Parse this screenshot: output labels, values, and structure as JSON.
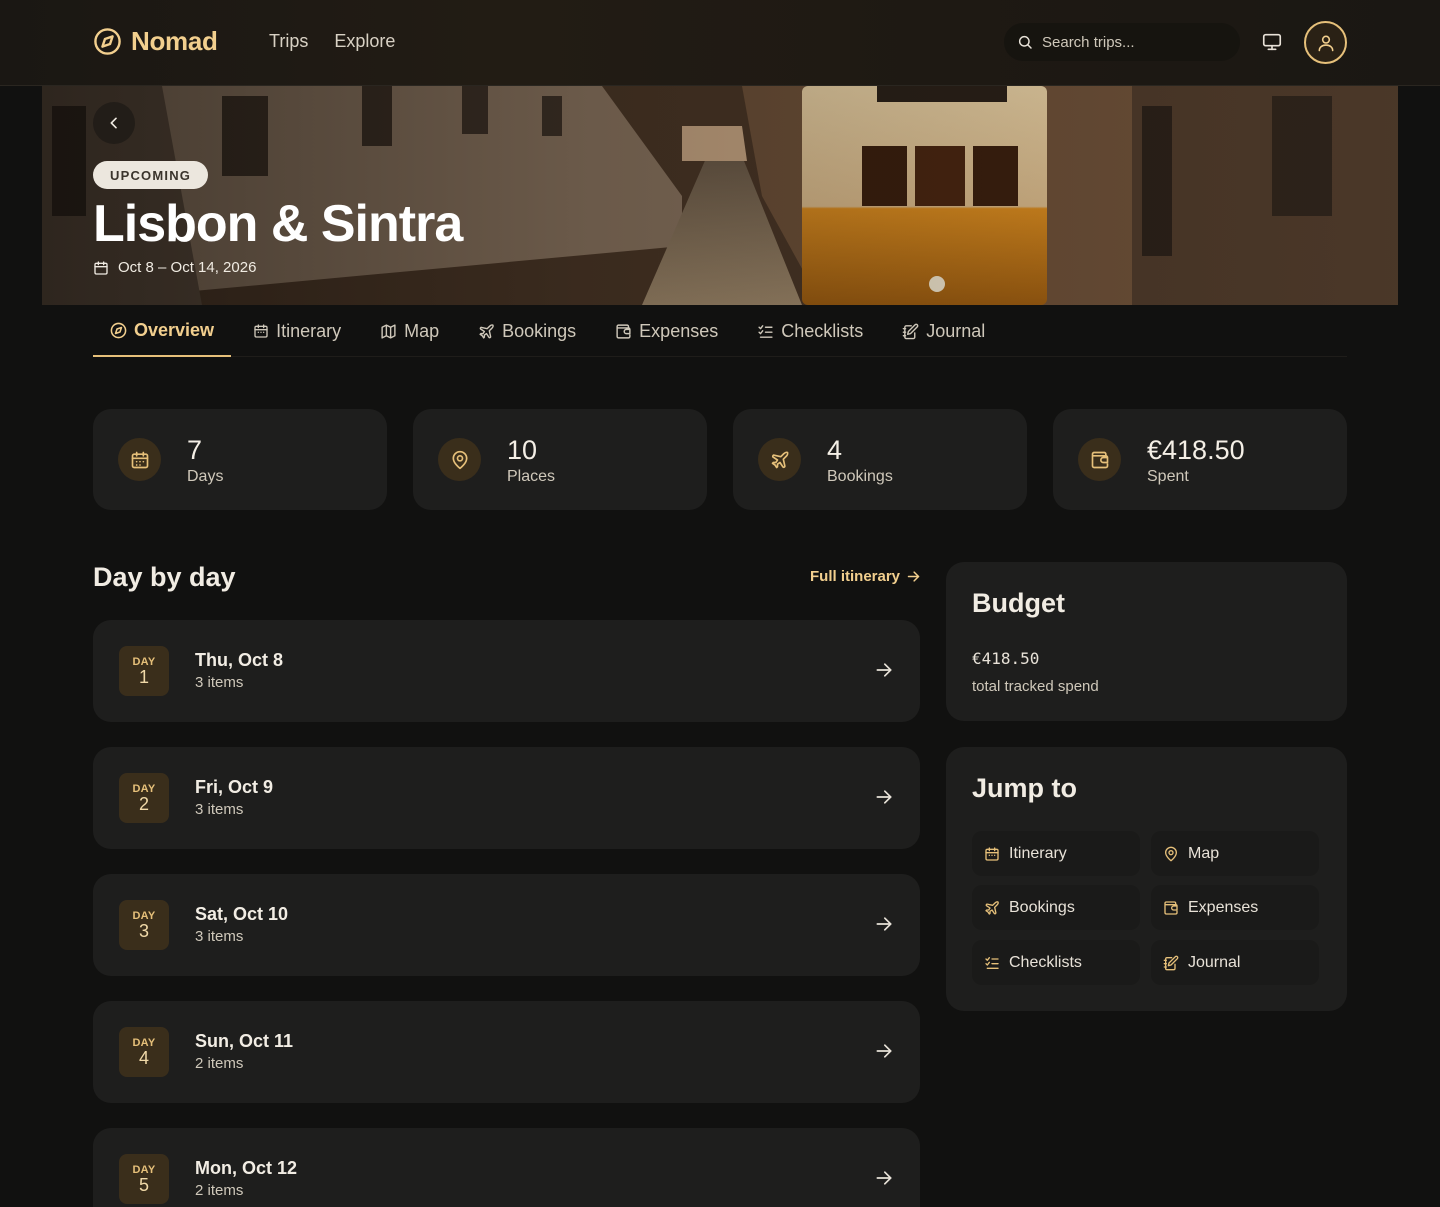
{
  "brand": {
    "name": "Nomad",
    "accent": "#F2CF8E"
  },
  "nav": {
    "links": [
      "Trips",
      "Explore"
    ]
  },
  "search": {
    "placeholder": "Search trips..."
  },
  "hero": {
    "status": "UPCOMING",
    "title": "Lisbon & Sintra",
    "dates": "Oct 8 – Oct 14, 2026"
  },
  "tabs": [
    {
      "label": "Overview",
      "icon": "compass-icon",
      "active": true
    },
    {
      "label": "Itinerary",
      "icon": "calendar-icon"
    },
    {
      "label": "Map",
      "icon": "map-icon"
    },
    {
      "label": "Bookings",
      "icon": "plane-icon"
    },
    {
      "label": "Expenses",
      "icon": "wallet-icon"
    },
    {
      "label": "Checklists",
      "icon": "checklist-icon"
    },
    {
      "label": "Journal",
      "icon": "journal-icon"
    }
  ],
  "stats": [
    {
      "value": "7",
      "label": "Days",
      "icon": "calendar-icon"
    },
    {
      "value": "10",
      "label": "Places",
      "icon": "map-pin-icon"
    },
    {
      "value": "4",
      "label": "Bookings",
      "icon": "plane-icon"
    },
    {
      "value": "€418.50",
      "label": "Spent",
      "icon": "wallet-icon"
    }
  ],
  "day_by_day": {
    "title": "Day by day",
    "full_link": "Full itinerary",
    "days": [
      {
        "badge": "DAY",
        "num": "1",
        "date": "Thu, Oct 8",
        "items": "3 items"
      },
      {
        "badge": "DAY",
        "num": "2",
        "date": "Fri, Oct 9",
        "items": "3 items"
      },
      {
        "badge": "DAY",
        "num": "3",
        "date": "Sat, Oct 10",
        "items": "3 items"
      },
      {
        "badge": "DAY",
        "num": "4",
        "date": "Sun, Oct 11",
        "items": "2 items"
      },
      {
        "badge": "DAY",
        "num": "5",
        "date": "Mon, Oct 12",
        "items": "2 items"
      }
    ]
  },
  "budget": {
    "title": "Budget",
    "amount": "€418.50",
    "subtitle": "total tracked spend"
  },
  "jump": {
    "title": "Jump to",
    "items": [
      {
        "label": "Itinerary",
        "icon": "calendar-icon"
      },
      {
        "label": "Map",
        "icon": "map-pin-icon"
      },
      {
        "label": "Bookings",
        "icon": "plane-icon"
      },
      {
        "label": "Expenses",
        "icon": "wallet-icon"
      },
      {
        "label": "Checklists",
        "icon": "checklist-icon"
      },
      {
        "label": "Journal",
        "icon": "journal-icon"
      }
    ]
  }
}
